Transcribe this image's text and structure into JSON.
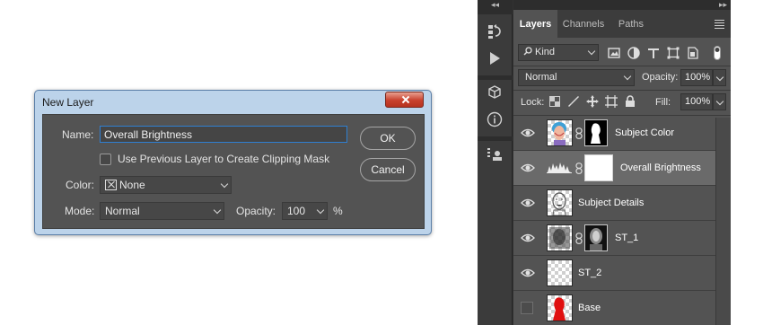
{
  "dialog": {
    "title": "New Layer",
    "name_label": "Name:",
    "name_value": "Overall Brightness",
    "clip_label": "Use Previous Layer to Create Clipping Mask",
    "color_label": "Color:",
    "color_value": "None",
    "mode_label": "Mode:",
    "mode_value": "Normal",
    "opacity_label": "Opacity:",
    "opacity_value": "100",
    "opacity_unit": "%",
    "ok_label": "OK",
    "cancel_label": "Cancel"
  },
  "panel": {
    "collapse_left": "◂◂",
    "collapse_right": "▸▸",
    "tabs": [
      "Layers",
      "Channels",
      "Paths"
    ],
    "kind_label": "Kind",
    "blend_mode": "Normal",
    "opacity_label": "Opacity:",
    "opacity_value": "100%",
    "lock_label": "Lock:",
    "fill_label": "Fill:",
    "fill_value": "100%",
    "layers": [
      {
        "name": "Subject Color",
        "visible": true
      },
      {
        "name": "Overall Brightness",
        "visible": true
      },
      {
        "name": "Subject Details",
        "visible": true
      },
      {
        "name": "ST_1",
        "visible": true
      },
      {
        "name": "ST_2",
        "visible": true
      },
      {
        "name": "Base",
        "visible": false
      }
    ]
  },
  "colors": {
    "panel_bg": "#535353",
    "selected_layer": "#6a6a6a",
    "focus_border": "#2f7fd1",
    "base_fill": "#e01010"
  }
}
